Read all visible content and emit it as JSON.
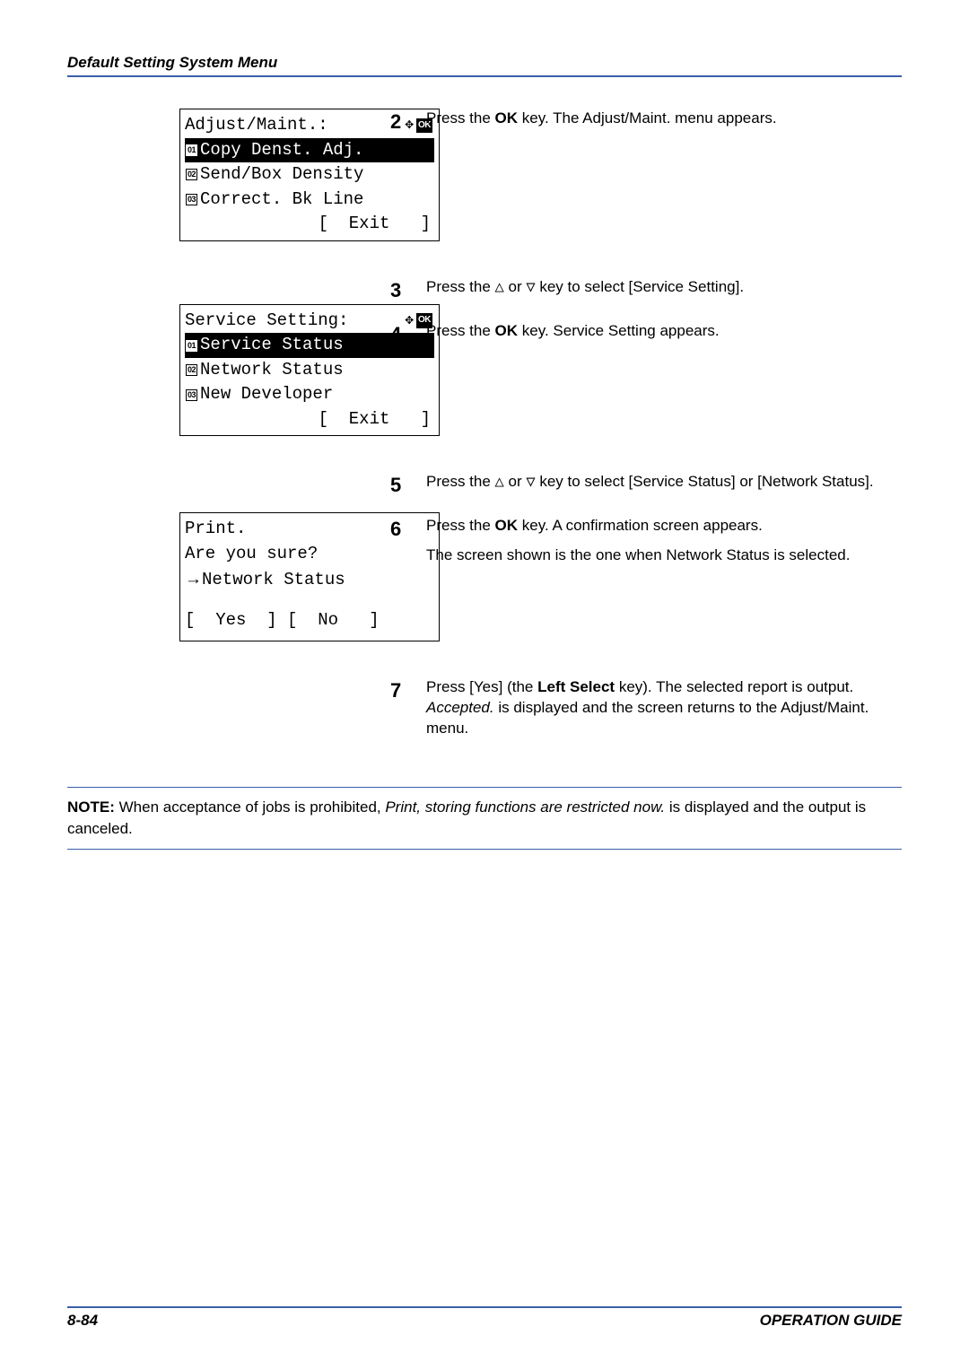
{
  "header": {
    "title": "Default Setting System Menu"
  },
  "lcd1": {
    "title": "Adjust/Maint.:",
    "ok": "OK",
    "items": [
      {
        "num": "01",
        "label": "Copy Denst. Adj.",
        "selected": true
      },
      {
        "num": "02",
        "label": "Send/Box Density",
        "selected": false
      },
      {
        "num": "03",
        "label": "Correct. Bk Line",
        "selected": false
      }
    ],
    "exit": "[  Exit   ]"
  },
  "lcd2": {
    "title": "Service Setting:",
    "ok": "OK",
    "items": [
      {
        "num": "01",
        "label": "Service Status",
        "selected": true
      },
      {
        "num": "02",
        "label": "Network Status",
        "selected": false
      },
      {
        "num": "03",
        "label": "New Developer",
        "selected": false
      }
    ],
    "exit": "[  Exit   ]"
  },
  "lcd3": {
    "line1": "Print.",
    "line2": "Are you sure?",
    "line3": "Network Status",
    "yesno": "[  Yes  ] [  No   ]"
  },
  "steps": {
    "s2": {
      "num": "2",
      "t1": "Press the ",
      "t2": "OK",
      "t3": " key. The Adjust/Maint. menu appears."
    },
    "s3": {
      "num": "3",
      "t1": "Press the ",
      "up": "△",
      "t2": " or ",
      "down": "▽",
      "t3": " key to select [Service Setting]."
    },
    "s4": {
      "num": "4",
      "t1": "Press the ",
      "t2": "OK",
      "t3": " key. Service Setting appears."
    },
    "s5": {
      "num": "5",
      "t1": "Press the ",
      "up": "△",
      "t2": " or ",
      "down": "▽",
      "t3": " key to select [Service Status] or [Network Status]."
    },
    "s6": {
      "num": "6",
      "t1": "Press the ",
      "t2": "OK",
      "t3": " key. A confirmation screen appears.",
      "p2": "The screen shown is the one when Network Status is selected."
    },
    "s7": {
      "num": "7",
      "t1": "Press [Yes] (the ",
      "t2": "Left Select",
      "t3": " key). The selected report is output. ",
      "t4": "Accepted.",
      "t5": " is displayed and the screen returns to the Adjust/Maint. menu."
    }
  },
  "note": {
    "label": "NOTE:",
    "t1": " When acceptance of jobs is prohibited, ",
    "t2": "Print, storing functions are restricted now.",
    "t3": " is displayed and the output is canceled."
  },
  "footer": {
    "left": "8-84",
    "right": "OPERATION GUIDE"
  }
}
